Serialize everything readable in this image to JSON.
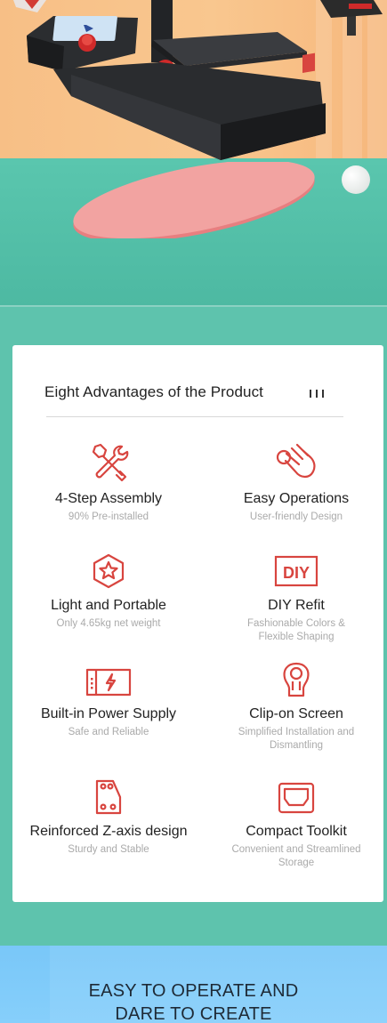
{
  "card": {
    "title": "Eight Advantages of the Product",
    "features": [
      {
        "name": "4-Step Assembly",
        "desc": "90% Pre-installed",
        "icon": "tools-icon"
      },
      {
        "name": "Easy Operations",
        "desc": "User-friendly Design",
        "icon": "hand-tap-icon"
      },
      {
        "name": "Light and Portable",
        "desc": "Only 4.65kg net weight",
        "icon": "star-badge-icon"
      },
      {
        "name": "DIY Refit",
        "desc": "Fashionable Colors & Flexible Shaping",
        "icon": "diy-icon",
        "icon_text": "DIY"
      },
      {
        "name": "Built-in Power Supply",
        "desc": "Safe and Reliable",
        "icon": "power-supply-icon"
      },
      {
        "name": "Clip-on Screen",
        "desc": "Simplified Installation and Dismantling",
        "icon": "clip-icon"
      },
      {
        "name": "Reinforced Z-axis design",
        "desc": "Sturdy and Stable",
        "icon": "bracket-icon"
      },
      {
        "name": "Compact Toolkit",
        "desc": "Convenient and Streamlined Storage",
        "icon": "toolkit-tray-icon"
      }
    ]
  },
  "slogan": {
    "line1": "EASY TO OPERATE AND",
    "line2": "DARE TO CREATE"
  },
  "colors": {
    "accent_red": "#d8453f",
    "teal": "#5ec3ad",
    "peach": "#f8c28a",
    "blue": "#7fcaf9"
  }
}
